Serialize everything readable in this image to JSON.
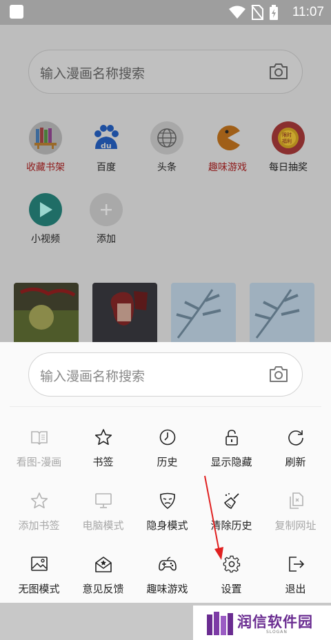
{
  "status_bar": {
    "time": "11:07"
  },
  "background": {
    "search_placeholder": "输入漫画名称搜索",
    "apps": [
      {
        "label": "收藏书架",
        "icon": "bookshelf-icon",
        "highlight": true
      },
      {
        "label": "百度",
        "icon": "baidu-icon",
        "highlight": false
      },
      {
        "label": "头条",
        "icon": "globe-icon",
        "highlight": false
      },
      {
        "label": "趣味游戏",
        "icon": "pacman-icon",
        "highlight": true
      },
      {
        "label": "每日抽奖",
        "icon": "lottery-icon",
        "highlight": false
      },
      {
        "label": "小视频",
        "icon": "play-icon",
        "highlight": false
      },
      {
        "label": "添加",
        "icon": "plus-icon",
        "highlight": false
      }
    ]
  },
  "sheet": {
    "search_placeholder": "输入漫画名称搜索",
    "menu": [
      {
        "label": "看图-漫画",
        "icon": "book-icon",
        "enabled": false
      },
      {
        "label": "书签",
        "icon": "star-icon",
        "enabled": true
      },
      {
        "label": "历史",
        "icon": "clock-icon",
        "enabled": true
      },
      {
        "label": "显示隐藏",
        "icon": "lock-icon",
        "enabled": true
      },
      {
        "label": "刷新",
        "icon": "refresh-icon",
        "enabled": true
      },
      {
        "label": "添加书签",
        "icon": "star-outline-icon",
        "enabled": false
      },
      {
        "label": "电脑模式",
        "icon": "monitor-icon",
        "enabled": false
      },
      {
        "label": "隐身模式",
        "icon": "mask-icon",
        "enabled": true
      },
      {
        "label": "清除历史",
        "icon": "broom-icon",
        "enabled": true
      },
      {
        "label": "复制网址",
        "icon": "copy-icon",
        "enabled": false
      },
      {
        "label": "无图模式",
        "icon": "image-icon",
        "enabled": true
      },
      {
        "label": "意见反馈",
        "icon": "feedback-icon",
        "enabled": true
      },
      {
        "label": "趣味游戏",
        "icon": "gamepad-icon",
        "enabled": true
      },
      {
        "label": "设置",
        "icon": "gear-icon",
        "enabled": true
      },
      {
        "label": "退出",
        "icon": "exit-icon",
        "enabled": true
      }
    ]
  },
  "watermark": {
    "brand": "润信软件园",
    "slogan": "SLOGAN"
  },
  "colors": {
    "arrow": "#e02020",
    "watermark": "#6a2c91",
    "highlight_label": "#8e1a1a"
  }
}
